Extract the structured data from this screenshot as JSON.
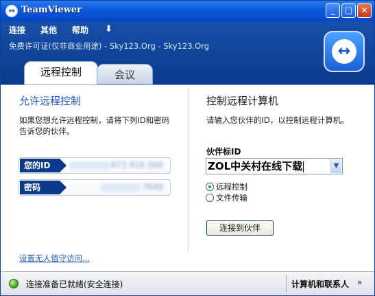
{
  "window": {
    "title": "TeamViewer",
    "controls": {
      "minimize": "_",
      "maximize": "□",
      "close": "✕"
    }
  },
  "menu": {
    "connect": "连接",
    "other": "其他",
    "help": "帮助",
    "download_icon": "download-icon",
    "download_glyph": "⬇"
  },
  "license_text": "免费许可证(仅非商业用途) - Sky123.Org - Sky123.Org",
  "logo": {
    "icon": "teamviewer-logo-icon",
    "glyph": "↔"
  },
  "tabs": [
    {
      "label": "远程控制",
      "active": true
    },
    {
      "label": "会议",
      "active": false
    }
  ],
  "allow_panel": {
    "title": "允许远程控制",
    "description": "如果您想允许远程控制，请将下列ID和密码告诉您的伙伴。",
    "id_label": "您的ID",
    "id_value": "973 916 560",
    "password_label": "密码",
    "password_value": "7649",
    "unattended_link": "设置无人值守访问..."
  },
  "control_panel": {
    "title": "控制远程计算机",
    "description": "请输入您伙伴的ID，以控制远程计算机。",
    "partner_id_label": "伙伴标ID",
    "partner_id_value": "ZOL中关村在线下载",
    "dropdown_glyph": "▼",
    "options": [
      {
        "label": "远程控制",
        "selected": true
      },
      {
        "label": "文件传输",
        "selected": false
      }
    ],
    "connect_button": "连接到伙伴"
  },
  "status": {
    "indicator_color": "#3c9a12",
    "text": "连接准备已就绪(安全连接)",
    "contacts_button": "计算机和联系人",
    "contacts_arrow": "»"
  },
  "colors": {
    "header": "#0c3a8a",
    "accent_title": "#1f56b8",
    "link": "#1f56b8"
  }
}
